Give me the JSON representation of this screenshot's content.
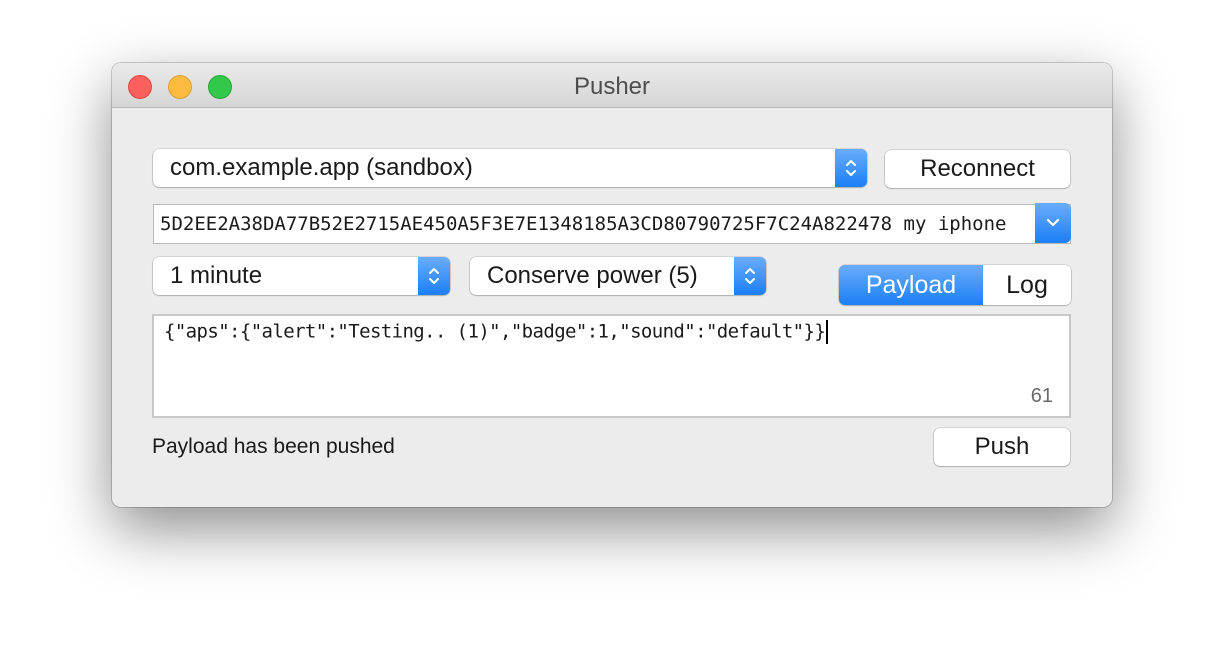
{
  "window": {
    "title": "Pusher",
    "controls": {
      "close": "close-button",
      "minimize": "minimize-button",
      "zoom": "zoom-button"
    }
  },
  "identity": {
    "selected": "com.example.app (sandbox)",
    "reconnect_label": "Reconnect"
  },
  "device_token": {
    "value": "5D2EE2A38DA77B52E2715AE450A5F3E7E1348185A3CD80790725F7C24A822478 my iphone"
  },
  "expiry": {
    "selected": "1 minute"
  },
  "priority": {
    "selected": "Conserve power (5)"
  },
  "tabs": [
    {
      "label": "Payload",
      "active": true
    },
    {
      "label": "Log",
      "active": false
    }
  ],
  "payload": {
    "text": "{\"aps\":{\"alert\":\"Testing.. (1)\",\"badge\":1,\"sound\":\"default\"}}",
    "char_count": "61"
  },
  "status": {
    "text": "Payload has been pushed"
  },
  "push_label": "Push",
  "colors": {
    "accent": "#1b7ff5",
    "close": "#fc605c",
    "minimize": "#fdbc40",
    "maximize": "#34c84a"
  }
}
